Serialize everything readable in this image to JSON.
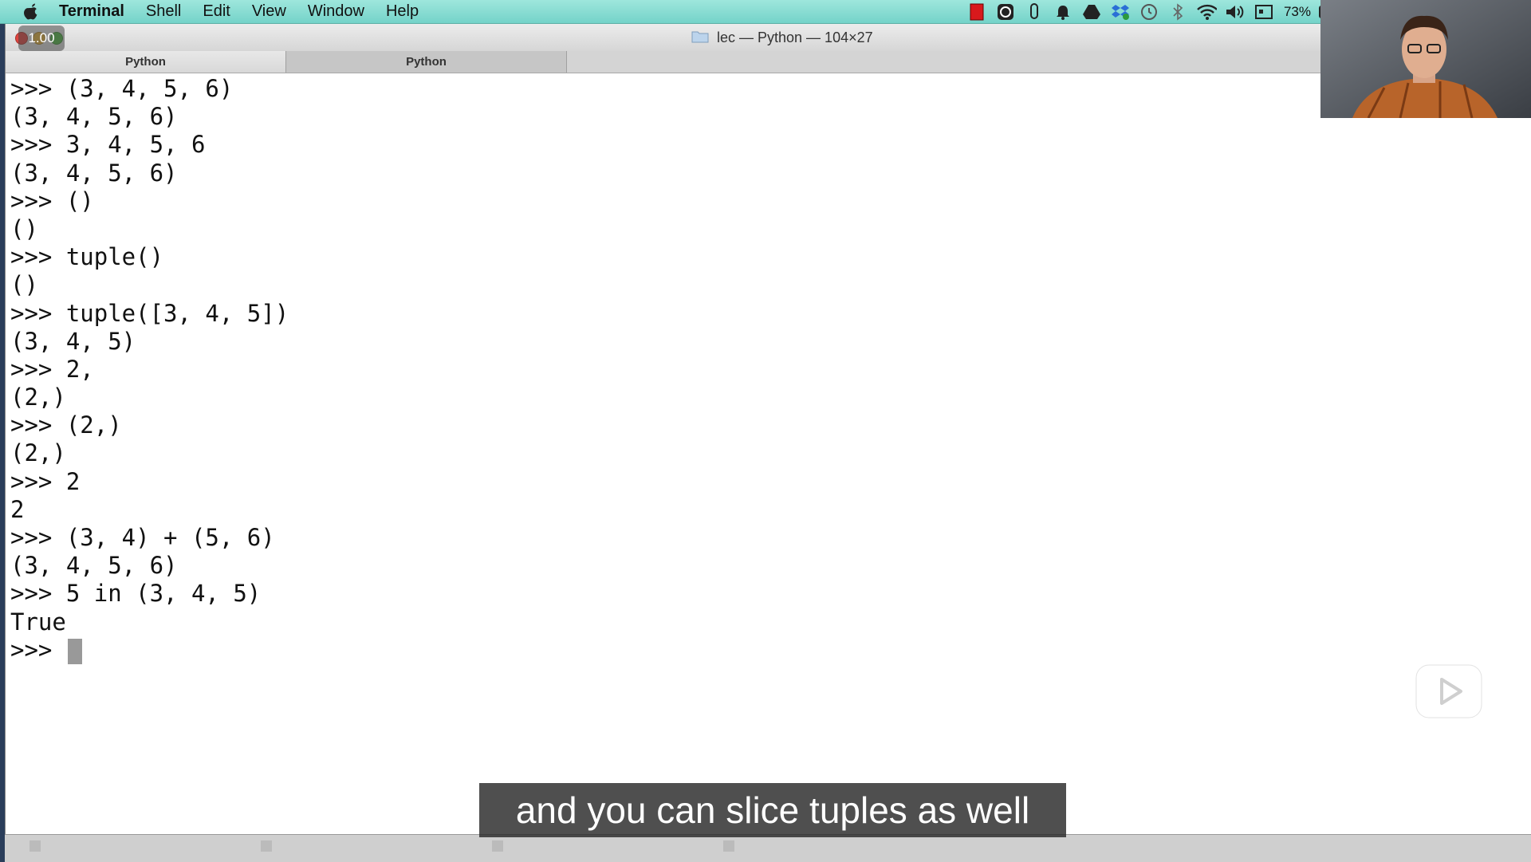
{
  "menubar": {
    "app_name": "Terminal",
    "menus": [
      "Shell",
      "Edit",
      "View",
      "Window",
      "Help"
    ],
    "battery": "73%",
    "tray_icons": [
      "record-icon",
      "clock-icon",
      "clip-icon",
      "bell-icon",
      "drive-icon",
      "dropbox-icon",
      "time-machine-icon",
      "bluetooth-icon",
      "wifi-icon",
      "volume-icon",
      "display-icon"
    ]
  },
  "window": {
    "title": "lec — Python — 104×27",
    "speed_badge": "1.00",
    "tabs": [
      "Python",
      "Python"
    ]
  },
  "terminal": {
    "lines": [
      ">>> (3, 4, 5, 6)",
      "(3, 4, 5, 6)",
      ">>> 3, 4, 5, 6",
      "(3, 4, 5, 6)",
      ">>> ()",
      "()",
      ">>> tuple()",
      "()",
      ">>> tuple([3, 4, 5])",
      "(3, 4, 5)",
      ">>> 2,",
      "(2,)",
      ">>> (2,)",
      "(2,)",
      ">>> 2",
      "2",
      ">>> (3, 4) + (5, 6)",
      "(3, 4, 5, 6)",
      ">>> 5 in (3, 4, 5)",
      "True"
    ],
    "prompt": ">>> "
  },
  "subtitle": "and you can slice tuples as well",
  "colors": {
    "menubar": "#7fd9cf",
    "terminal_bg": "#ffffff",
    "text": "#111111"
  }
}
